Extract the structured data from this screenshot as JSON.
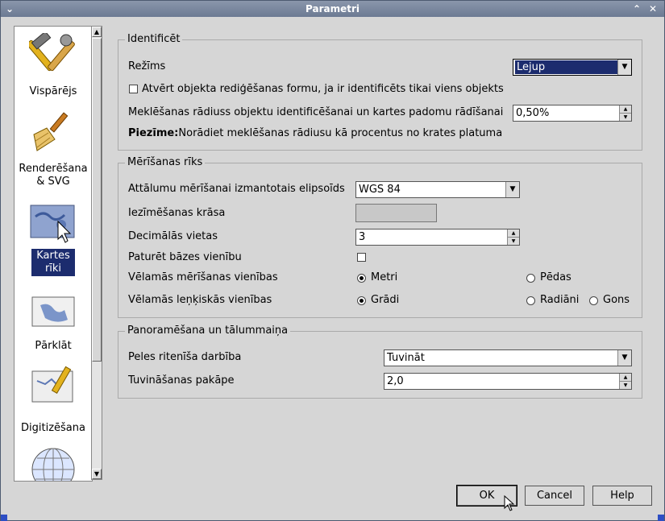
{
  "window": {
    "title": "Parametri",
    "menu_glyph": "⌄",
    "restore_glyph": "⌃",
    "close_glyph": "✕"
  },
  "sidebar": {
    "items": [
      {
        "label": "Vispārējs",
        "icon": "tools-icon"
      },
      {
        "label": "Renderēšana & SVG",
        "icon": "paintbrush-icon"
      },
      {
        "label": "Kartes rīki",
        "icon": "map-cursor-icon",
        "selected": true
      },
      {
        "label": "Pārklāt",
        "icon": "overlay-map-icon"
      },
      {
        "label": "Digitizēšana",
        "icon": "digitize-pencil-icon"
      },
      {
        "label": "",
        "icon": "globe-icon"
      }
    ]
  },
  "identify": {
    "title": "Identificēt",
    "mode_label": "Režīms",
    "mode_value": "Lejup",
    "open_form_label": "Atvērt objekta rediģēšanas formu, ja ir identificēts tikai viens objekts",
    "open_form_checked": false,
    "radius_label": "Meklēšanas rādiuss objektu identificēšanai un kartes padomu rādīšanai",
    "radius_value": "0,50%",
    "note_bold": "Piezīme:",
    "note_text": "Norādiet meklēšanas rādiusu kā procentus no krates platuma"
  },
  "measure": {
    "title": "Mērīšanas rīks",
    "ellipsoid_label": "Attālumu mērīšanai izmantotais elipsoīds",
    "ellipsoid_value": "WGS 84",
    "color_label": "Iezīmēšanas krāsa",
    "color_value": "#c8c8c8",
    "decimals_label": "Decimālās vietas",
    "decimals_value": "3",
    "keep_base_label": "Paturēt bāzes vienību",
    "keep_base_checked": false,
    "units_label": "Vēlamās mērīšanas vienības",
    "unit_meters": "Metri",
    "unit_feet": "Pēdas",
    "unit_selected": "meters",
    "angle_label": "Vēlamās leņķiskās vienības",
    "angle_degrees": "Grādi",
    "angle_radians": "Radiāni",
    "angle_gon": "Gons",
    "angle_selected": "degrees"
  },
  "pan": {
    "title": "Panoramēšana un tālummaiņa",
    "wheel_label": "Peles ritenīša darbība",
    "wheel_value": "Tuvināt",
    "zoom_label": "Tuvināšanas pakāpe",
    "zoom_value": "2,0"
  },
  "buttons": {
    "ok": "OK",
    "cancel": "Cancel",
    "help": "Help"
  }
}
